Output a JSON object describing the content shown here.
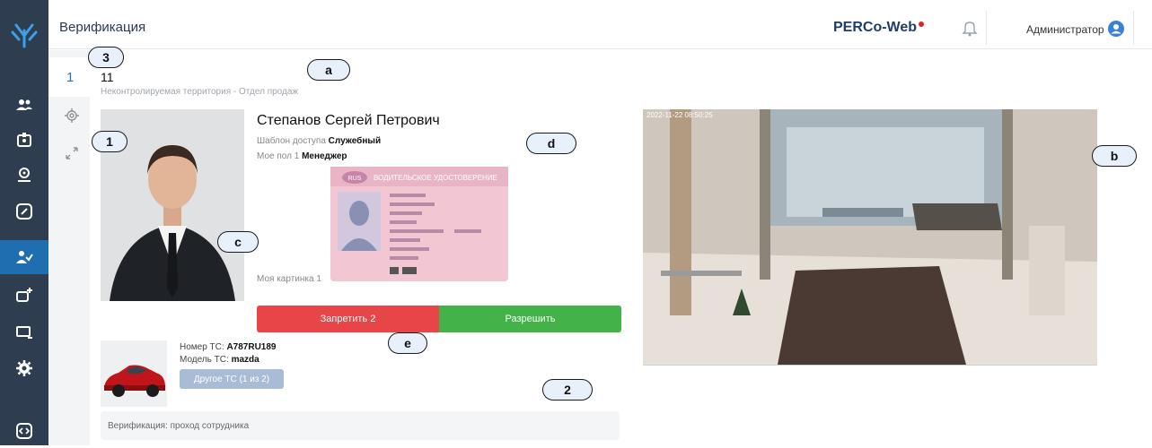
{
  "header": {
    "page_title": "Верификация",
    "brand": "PERCo-Web",
    "user_name": "Администратор"
  },
  "tabs": {
    "active_number": "1"
  },
  "verification": {
    "device_name": "11",
    "territory": "Неконтролируемая территория - Отдел продаж",
    "employee_name": "Степанов Сергей Петрович",
    "access_template_label": "Шаблон доступа",
    "access_template_value": "Служебный",
    "custom_field_label": "Мое пол 1",
    "custom_field_value": "Менеджер",
    "picture_label": "Моя картинка 1",
    "deny_button": "Запретить 2",
    "allow_button": "Разрешить",
    "vehicle_number_label": "Номер ТС:",
    "vehicle_number_value": "A787RU189",
    "vehicle_model_label": "Модель ТС:",
    "vehicle_model_value": "mazda",
    "other_vehicle_button": "Другое ТС (1 из 2)",
    "status": "Верификация: проход сотрудника"
  },
  "license": {
    "header": "ВОДИТЕЛЬСКОЕ УДОСТОВЕРЕНИЕ",
    "country": "RUS"
  },
  "camera": {
    "timestamp": "2022-11-22 08:50:25"
  },
  "callouts": [
    "1",
    "2",
    "3",
    "a",
    "b",
    "c",
    "d",
    "e"
  ],
  "colors": {
    "sidebar": "#2e3d4f",
    "active": "#1f6fb0",
    "deny": "#e84548",
    "allow": "#43b349",
    "brand_dot": "#e0202e"
  },
  "icons": [
    "logo-icon",
    "users-icon",
    "badge-icon",
    "location-icon",
    "link-icon",
    "verify-icon",
    "add-badge-icon",
    "monitor-icon",
    "gear-icon",
    "expand-icon",
    "bell-icon",
    "user-avatar-icon",
    "help-icon",
    "settings-icon"
  ]
}
